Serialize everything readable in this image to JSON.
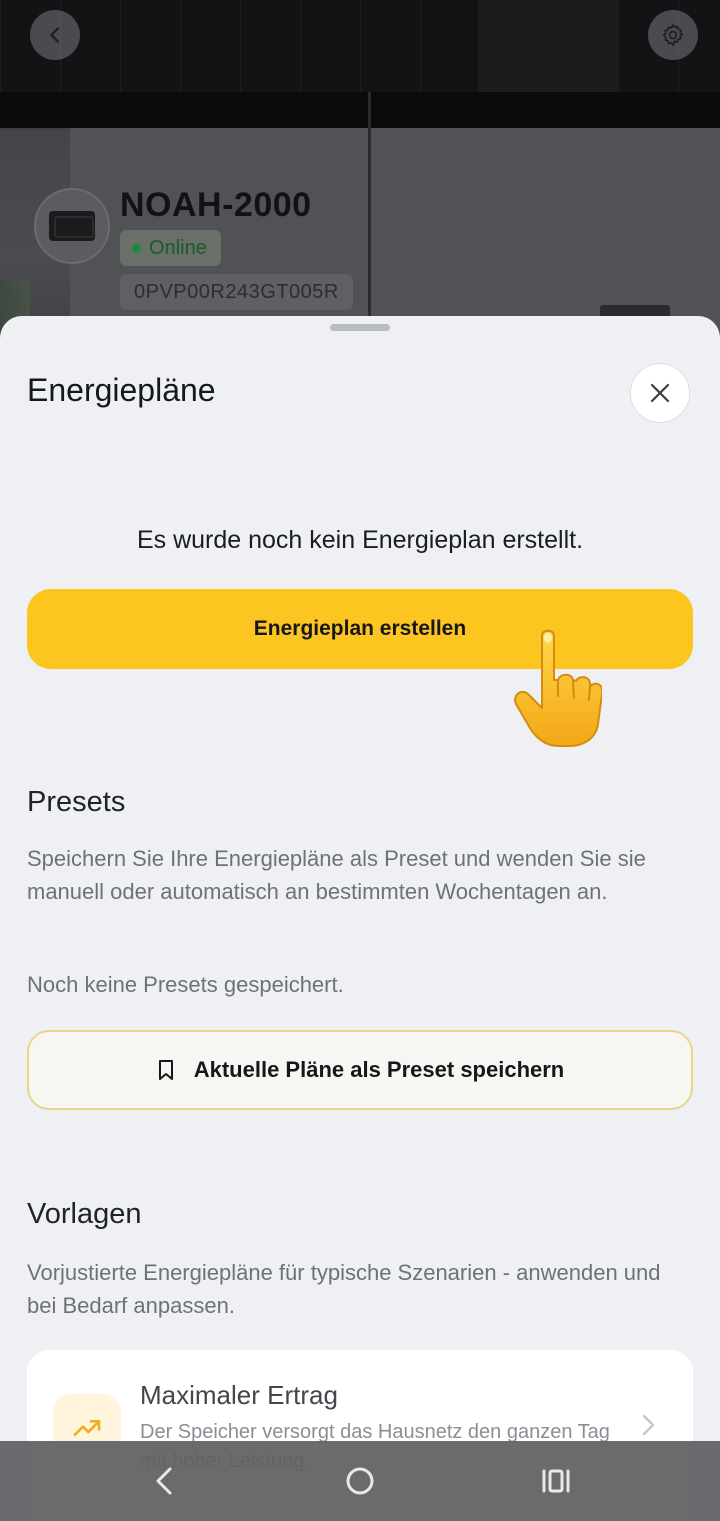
{
  "header": {
    "device_name": "NOAH-2000",
    "status": "Online",
    "serial": "0PVP00R243GT005R",
    "status_color": "#1c8a3a"
  },
  "sheet": {
    "title": "Energiepläne",
    "empty_message": "Es wurde noch kein Energieplan erstellt.",
    "create_button": "Energieplan erstellen",
    "accent_color": "#fdc51f"
  },
  "presets": {
    "title": "Presets",
    "description": "Speichern Sie Ihre Energiepläne als Preset und wenden Sie sie manuell oder automatisch an bestimmten Wochentagen an.",
    "empty": "Noch keine Presets gespeichert.",
    "save_button": "Aktuelle Pläne als Preset speichern"
  },
  "templates": {
    "title": "Vorlagen",
    "description": "Vorjustierte Energiepläne für typische Szenarien - anwenden und bei Bedarf anpassen.",
    "items": [
      {
        "name": "Maximaler Ertrag",
        "description": "Der Speicher versorgt das Hausnetz den ganzen Tag mit hoher Leistung.",
        "icon": "trending-up-icon"
      }
    ]
  },
  "icons": {
    "back": "chevron-left-icon",
    "settings": "gear-icon",
    "close": "close-icon",
    "bookmark": "bookmark-icon",
    "pointer": "pointing-hand-icon"
  }
}
